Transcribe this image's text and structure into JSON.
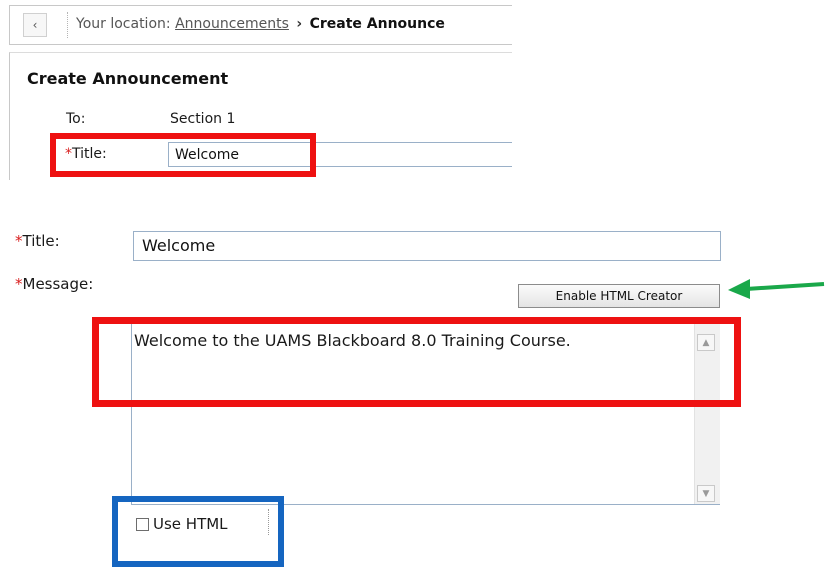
{
  "breadcrumb": {
    "back_icon": "chevron-left-icon",
    "prefix": "Your location:",
    "link": "Announcements",
    "separator": "›",
    "current": "Create Announce"
  },
  "panel": {
    "heading": "Create Announcement",
    "to_label": "To:",
    "to_value": "Section 1",
    "required_marker": "*",
    "title_label": "Title:",
    "title_value": "Welcome"
  },
  "form": {
    "required_marker": "*",
    "title_label": "Title:",
    "title_value": "Welcome",
    "message_label": "Message:",
    "html_creator_button": "Enable HTML Creator",
    "message_value": "Welcome to the UAMS Blackboard 8.0 Training Course.",
    "use_html_label": "Use HTML",
    "use_html_checked": false
  },
  "annotations": {
    "red_color": "#ee1111",
    "blue_color": "#1565c0",
    "green_color": "#1aa84a"
  }
}
